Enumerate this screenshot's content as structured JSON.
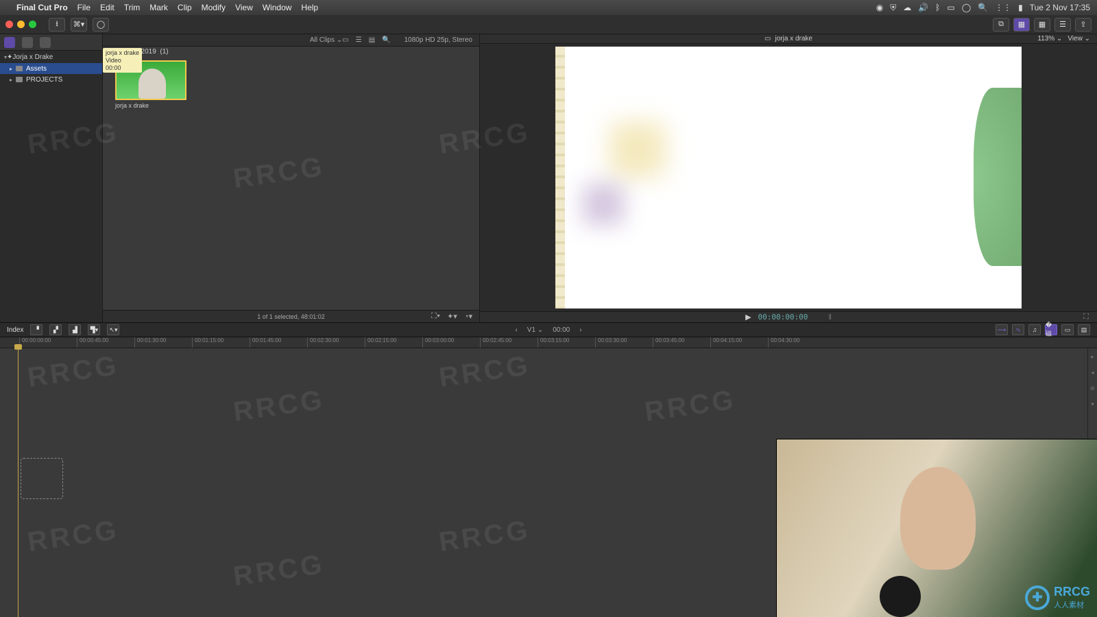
{
  "menubar": {
    "app": "Final Cut Pro",
    "items": [
      "File",
      "Edit",
      "Trim",
      "Mark",
      "Clip",
      "Modify",
      "View",
      "Window",
      "Help"
    ],
    "clock": "Tue 2 Nov  17:35"
  },
  "sidebar": {
    "library": "Jorja x Drake",
    "rows": [
      {
        "label": "Assets",
        "selected": true
      },
      {
        "label": "PROJECTS",
        "selected": false
      }
    ]
  },
  "browser": {
    "filter_label": "All Clips",
    "format_info": "1080p HD 25p, Stereo",
    "date_group": "lov 2019",
    "date_count": "(1)",
    "tooltip": {
      "title": "jorja x drake",
      "line2": "Video",
      "line3": "00:00"
    },
    "clip_name": "jorja x drake",
    "footer": "1 of 1 selected, 48:01:02"
  },
  "viewer": {
    "project_name": "jorja x drake",
    "zoom": "113%",
    "view_label": "View",
    "timecode": "00:00:00:00"
  },
  "timeline": {
    "index_label": "Index",
    "track_label": "V1",
    "track_tc": "00:00",
    "ruler": [
      "00:00:00:00",
      "00:00:45:00",
      "00:01:30:00",
      "00:01:15:00",
      "00:01:45:00",
      "00:02:30:00",
      "00:02:15:00",
      "00:03:00:00",
      "00:02:45:00",
      "00:03:15:00",
      "00:03:30:00",
      "00:03:45:00",
      "00:04:15:00",
      "00:04:30:00"
    ]
  },
  "watermark": "RRCG",
  "webcam_logo": {
    "text": "RRCG",
    "sub": "人人素材"
  }
}
